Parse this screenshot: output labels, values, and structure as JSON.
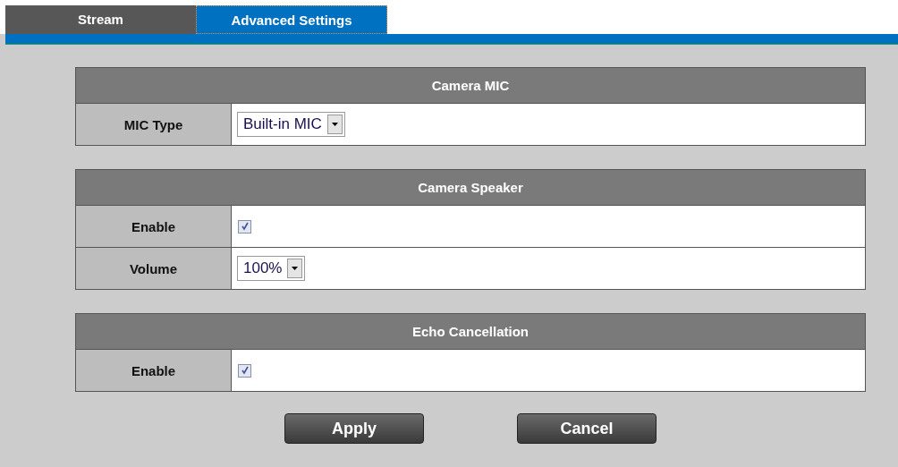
{
  "tabs": [
    {
      "label": "Stream",
      "selected": false
    },
    {
      "label": "Advanced Settings",
      "selected": true
    }
  ],
  "sections": [
    {
      "title": "Camera MIC",
      "rows": [
        {
          "kind": "select",
          "label": "MIC Type",
          "value": "Built-in MIC"
        }
      ]
    },
    {
      "title": "Camera Speaker",
      "rows": [
        {
          "kind": "checkbox",
          "label": "Enable",
          "checked": true
        },
        {
          "kind": "select",
          "label": "Volume",
          "value": "100%"
        }
      ]
    },
    {
      "title": "Echo Cancellation",
      "rows": [
        {
          "kind": "checkbox",
          "label": "Enable",
          "checked": true
        }
      ]
    }
  ],
  "buttons": [
    "Apply",
    "Cancel"
  ]
}
